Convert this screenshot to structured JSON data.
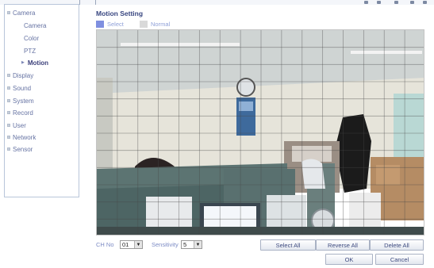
{
  "sidebar": {
    "camera": "Camera",
    "sub": {
      "camera": "Camera",
      "color": "Color",
      "ptz": "PTZ",
      "motion": "Motion"
    },
    "display": "Display",
    "sound": "Sound",
    "system": "System",
    "record": "Record",
    "user": "User",
    "network": "Network",
    "sensor": "Sensor"
  },
  "main": {
    "title": "Motion Setting",
    "legend": {
      "select_label": "Select",
      "normal_label": "Normal",
      "select_color": "#7f8fe0",
      "normal_color": "#d9d9d9"
    }
  },
  "controls": {
    "ch_label": "CH No",
    "ch_value": "01",
    "sensitivity_label": "Sensitivity",
    "sensitivity_value": "5",
    "select_all": "Select All",
    "reverse_all": "Reverse All",
    "delete_all": "Delete All",
    "ok": "OK",
    "cancel": "Cancel"
  },
  "grid": {
    "columns": 16,
    "rows": 12
  }
}
